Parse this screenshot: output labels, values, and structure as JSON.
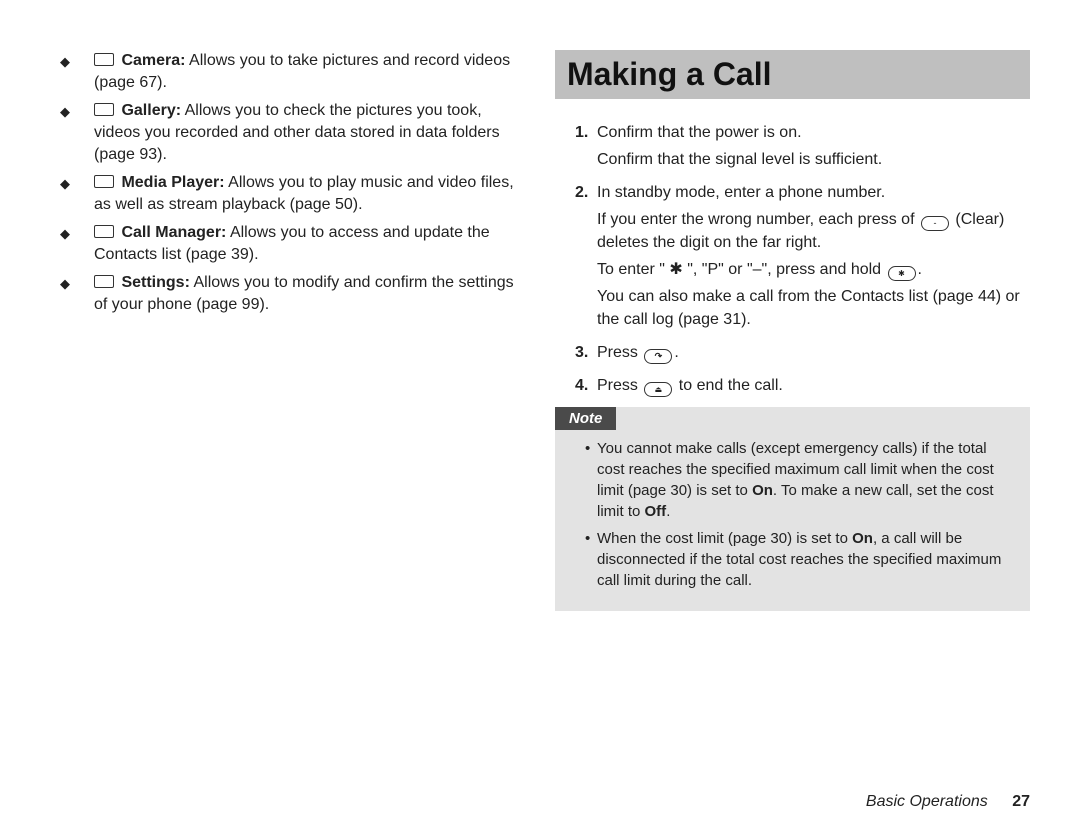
{
  "left": {
    "items": [
      {
        "icon": "camera-icon",
        "label": "Camera:",
        "desc": " Allows you to take pictures and record videos (page 67)."
      },
      {
        "icon": "gallery-icon",
        "label": "Gallery:",
        "desc": " Allows you to check the pictures you took, videos you recorded and other data stored in data folders (page 93)."
      },
      {
        "icon": "media-icon",
        "label": "Media Player:",
        "desc": " Allows you to play music and video files, as well as stream playback (page 50)."
      },
      {
        "icon": "contacts-icon",
        "label": "Call Manager:",
        "desc": " Allows you to access and update the Contacts list (page 39)."
      },
      {
        "icon": "settings-icon",
        "label": "Settings:",
        "desc": " Allows you to modify and confirm the settings of your phone (page 99)."
      }
    ]
  },
  "right": {
    "heading": "Making a Call",
    "step1a": "Confirm that the power is on.",
    "step1b": "Confirm that the signal level is sufficient.",
    "step2a": "In standby mode, enter a phone number.",
    "step2b_pre": "If you enter the wrong number, each press of ",
    "step2b_post": " (Clear) deletes the digit on the far right.",
    "step2c_pre": "To enter \" ✱ \", \"P\" or \"–\", press and hold ",
    "step2c_post": ".",
    "step2d": "You can also make a call from the Contacts list (page 44) or the call log (page 31).",
    "step3_pre": "Press ",
    "step3_post": ".",
    "step4_pre": "Press ",
    "step4_post": " to end the call.",
    "note_label": "Note",
    "note1_pre": "You cannot make calls (except emergency calls) if the total cost reaches the specified maximum call limit when the cost limit (page 30) is set to ",
    "note1_on": "On",
    "note1_mid": ". To make a new call, set the cost limit to ",
    "note1_off": "Off",
    "note1_end": ".",
    "note2_pre": "When the cost limit (page 30) is set to ",
    "note2_on": "On",
    "note2_post": ", a call will be disconnected if the total cost reaches the specified maximum call limit during the call."
  },
  "footer": {
    "label": "Basic Operations",
    "page": "27"
  }
}
